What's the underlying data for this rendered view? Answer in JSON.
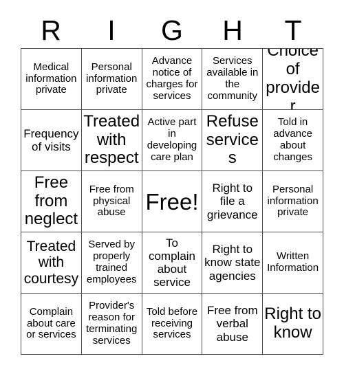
{
  "card": {
    "title_letters": [
      "R",
      "I",
      "G",
      "H",
      "T"
    ],
    "columns": 5,
    "rows": 5,
    "border_color": "#4d4d4d",
    "background_color": "#ffffff",
    "text_color": "#000000",
    "cells": [
      {
        "text": "Medical information private",
        "size": "s"
      },
      {
        "text": "Personal information private",
        "size": "s"
      },
      {
        "text": "Advance notice of charges for services",
        "size": "s"
      },
      {
        "text": "Services available in the community",
        "size": "s"
      },
      {
        "text": "Choice of provider",
        "size": "xl"
      },
      {
        "text": "Frequency of visits",
        "size": "m"
      },
      {
        "text": "Treated with respect",
        "size": "xl"
      },
      {
        "text": "Active part in developing care plan",
        "size": "s"
      },
      {
        "text": "Refuse services",
        "size": "xl"
      },
      {
        "text": "Told in advance about changes",
        "size": "s"
      },
      {
        "text": "Free from neglect",
        "size": "xl"
      },
      {
        "text": "Free from physical abuse",
        "size": "s"
      },
      {
        "text": "Free!",
        "size": "free"
      },
      {
        "text": "Right to file a grievance",
        "size": "m"
      },
      {
        "text": "Personal information private",
        "size": "s"
      },
      {
        "text": "Treated with courtesy",
        "size": "l"
      },
      {
        "text": "Served by properly trained employees",
        "size": "s"
      },
      {
        "text": "To complain about service",
        "size": "m"
      },
      {
        "text": "Right to know state agencies",
        "size": "m"
      },
      {
        "text": "Written Information",
        "size": "s"
      },
      {
        "text": "Complain about care or services",
        "size": "s"
      },
      {
        "text": "Provider's reason for terminating services",
        "size": "s"
      },
      {
        "text": "Told before receiving services",
        "size": "s"
      },
      {
        "text": "Free from verbal abuse",
        "size": "m"
      },
      {
        "text": "Right to know",
        "size": "xl"
      }
    ]
  }
}
